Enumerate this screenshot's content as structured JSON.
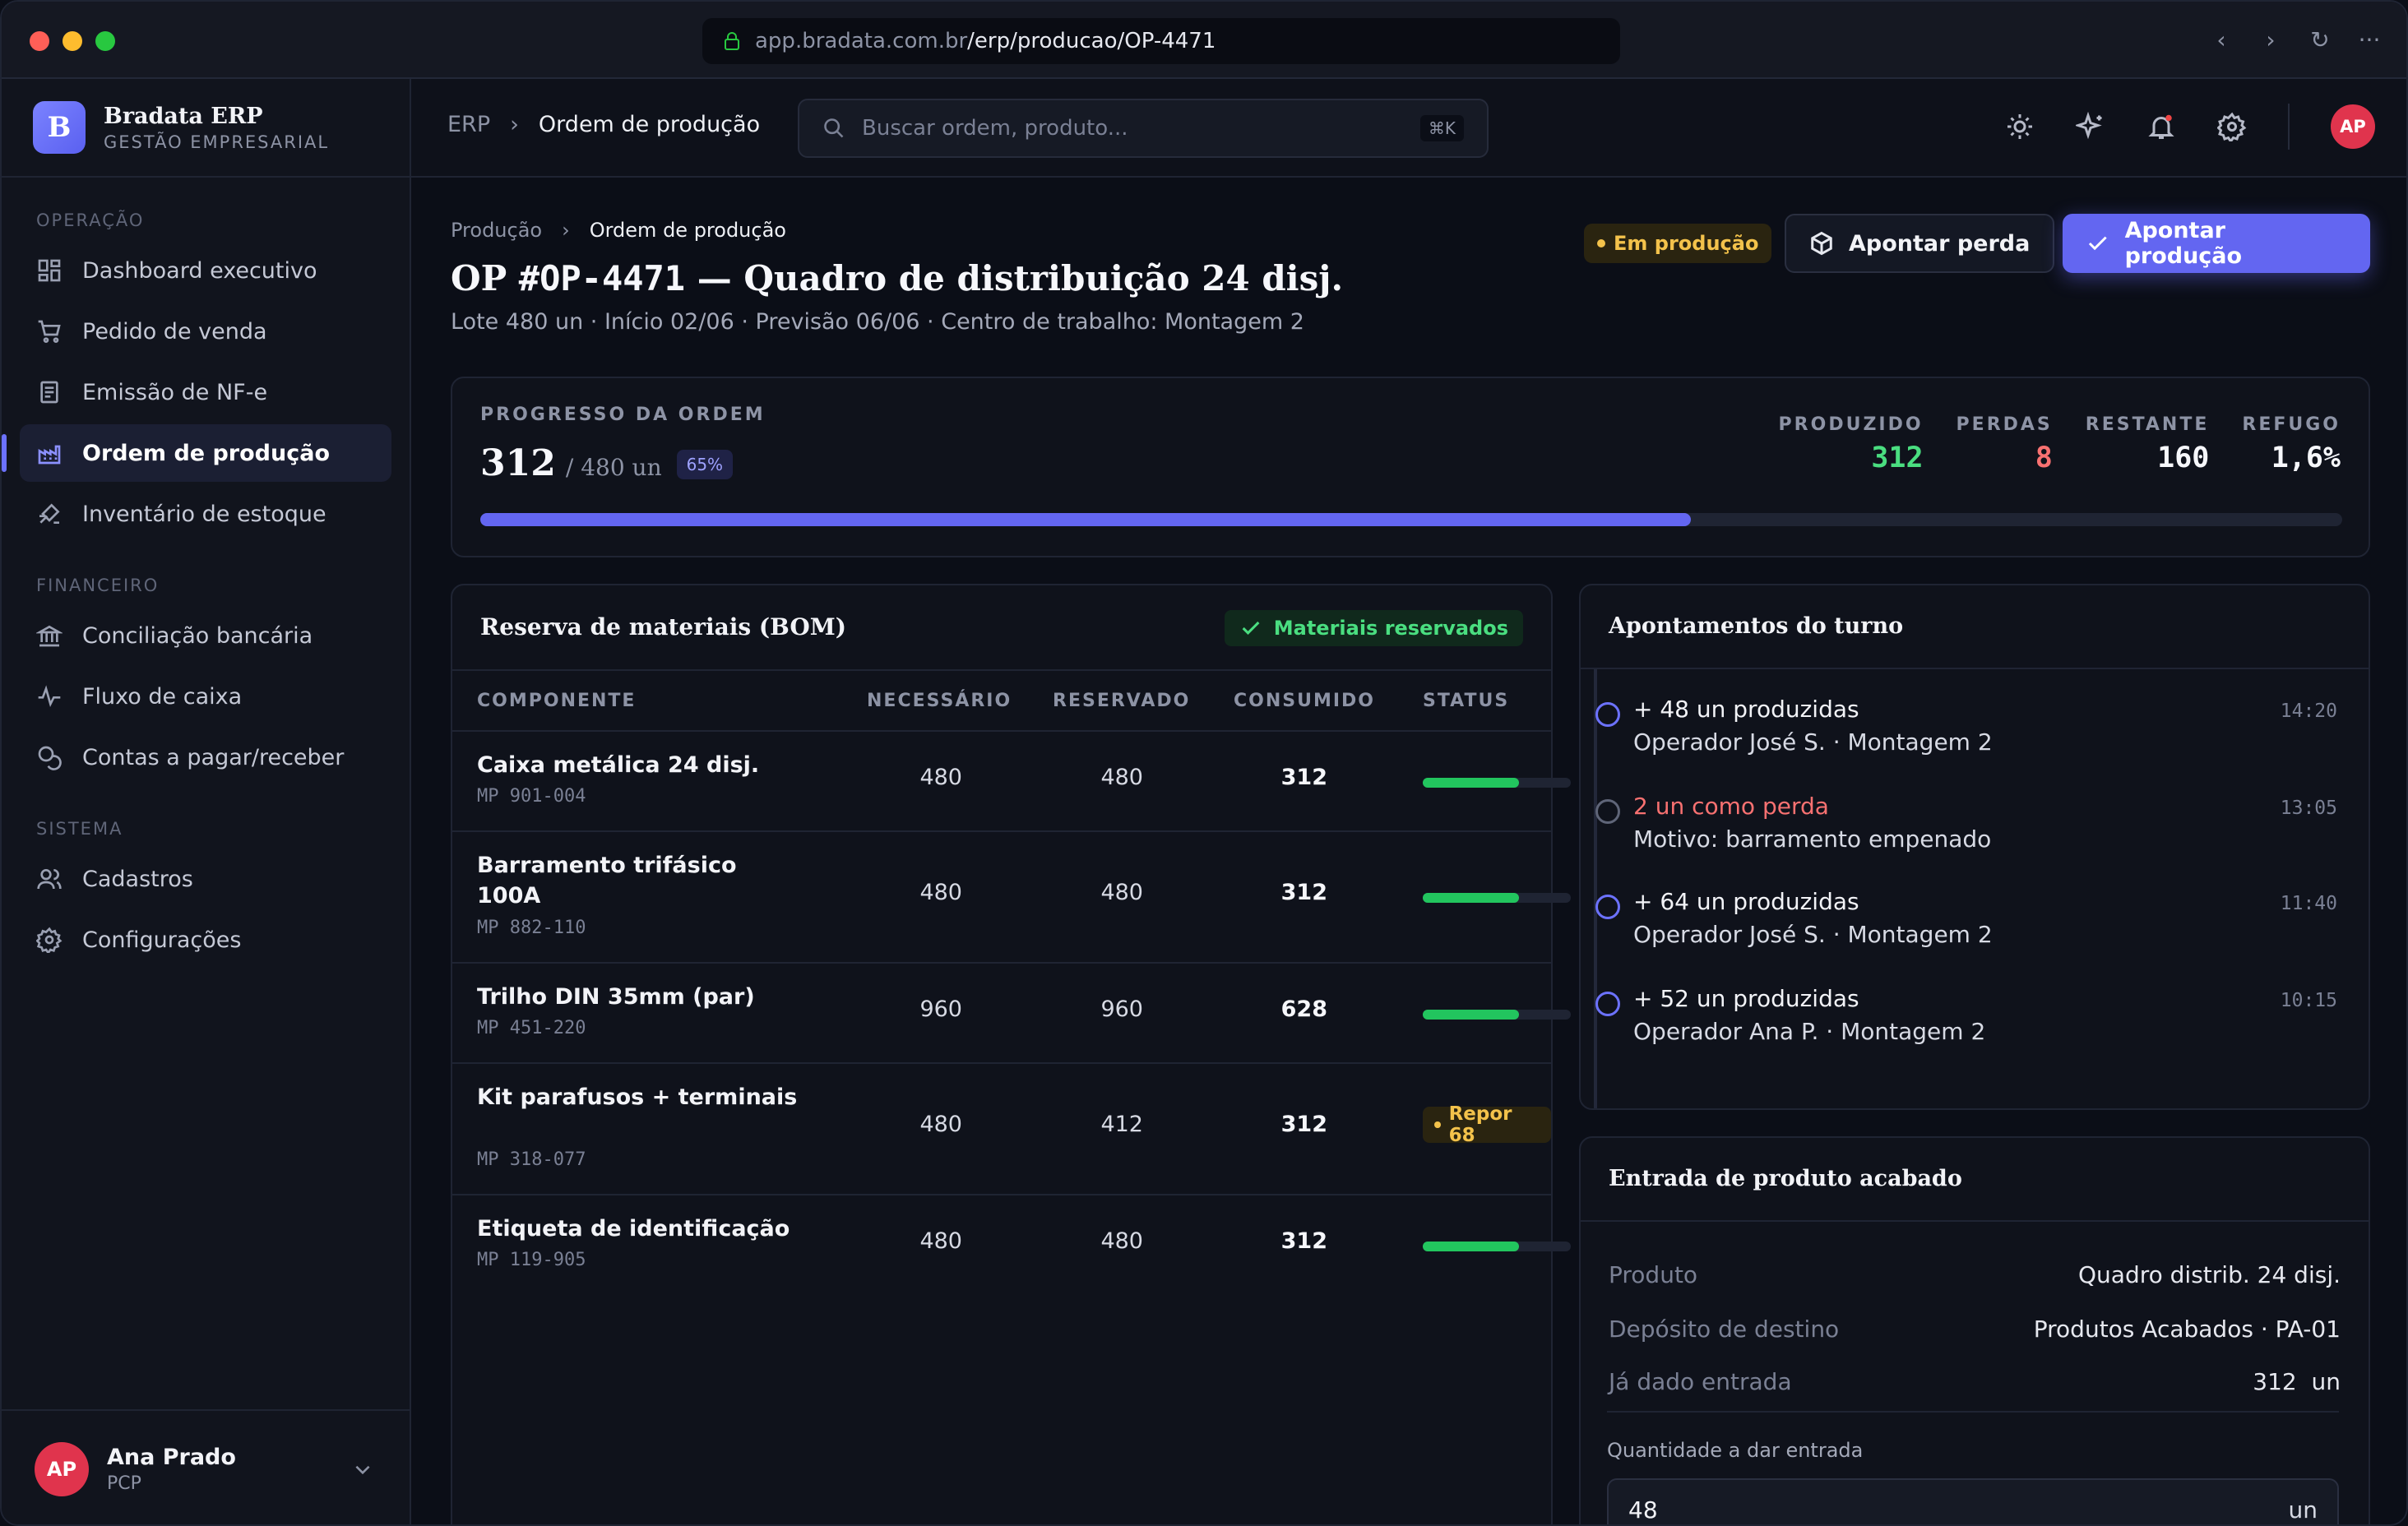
{
  "browser": {
    "url_host": "app.bradata.com.br",
    "url_path": "/erp/producao/OP-4471"
  },
  "brand": {
    "logo_letter": "B",
    "name": "Bradata ERP",
    "subtitle": "GESTÃO EMPRESARIAL"
  },
  "sidebar": {
    "sections": [
      {
        "title": "OPERAÇÃO",
        "items": [
          {
            "label": "Dashboard executivo",
            "icon": "grid-icon"
          },
          {
            "label": "Pedido de venda",
            "icon": "cart-icon"
          },
          {
            "label": "Emissão de NF-e",
            "icon": "document-icon"
          },
          {
            "label": "Ordem de produção",
            "icon": "factory-icon",
            "active": true
          },
          {
            "label": "Inventário de estoque",
            "icon": "inventory-icon"
          }
        ]
      },
      {
        "title": "FINANCEIRO",
        "items": [
          {
            "label": "Conciliação bancária",
            "icon": "bank-icon"
          },
          {
            "label": "Fluxo de caixa",
            "icon": "activity-icon"
          },
          {
            "label": "Contas a pagar/receber",
            "icon": "coins-icon"
          }
        ]
      },
      {
        "title": "SISTEMA",
        "items": [
          {
            "label": "Cadastros",
            "icon": "users-icon"
          },
          {
            "label": "Configurações",
            "icon": "gear-icon"
          }
        ]
      }
    ],
    "user": {
      "initials": "AP",
      "name": "Ana Prado",
      "role": "PCP"
    }
  },
  "topbar": {
    "crumb_root": "ERP",
    "crumb_current": "Ordem de produção",
    "search_placeholder": "Buscar ordem, produto...",
    "search_shortcut": "⌘K",
    "avatar_initials": "AP"
  },
  "page": {
    "breadcrumb_parent": "Produção",
    "breadcrumb_current": "Ordem de produção",
    "title_prefix": "OP ",
    "title_code": "#OP-4471",
    "title_suffix": " — Quadro de distribuição 24 disj.",
    "subtitle": "Lote 480 un · Início 02/06 · Previsão 06/06 · Centro de trabalho: Montagem 2",
    "status": "Em produção",
    "btn_loss": "Apontar perda",
    "btn_production": "Apontar produção"
  },
  "progress": {
    "label": "PROGRESSO DA ORDEM",
    "produced": "312",
    "of_total": "/ 480 un",
    "percent_label": "65%",
    "fraction": 0.65,
    "stats": [
      {
        "key": "PRODUZIDO",
        "value": "312",
        "color": "#4ade80"
      },
      {
        "key": "PERDAS",
        "value": "8",
        "color": "#f87171"
      },
      {
        "key": "RESTANTE",
        "value": "160",
        "color": "#f6f7fb"
      },
      {
        "key": "REFUGO",
        "value": "1,6%",
        "color": "#f6f7fb"
      }
    ]
  },
  "bom": {
    "title": "Reserva de materiais (BOM)",
    "badge": "Materiais reservados",
    "columns": [
      "COMPONENTE",
      "NECESSÁRIO",
      "RESERVADO",
      "CONSUMIDO",
      "STATUS"
    ],
    "rows": [
      {
        "name": "Caixa metálica 24 disj.",
        "code": "MP 901-004",
        "needed": "480",
        "reserved": "480",
        "consumed": "312",
        "status": "bar",
        "fill": 0.65
      },
      {
        "name": "Barramento trifásico 100A",
        "code": "MP 882-110",
        "needed": "480",
        "reserved": "480",
        "consumed": "312",
        "status": "bar",
        "fill": 0.65
      },
      {
        "name": "Trilho DIN 35mm (par)",
        "code": "MP 451-220",
        "needed": "960",
        "reserved": "960",
        "consumed": "628",
        "status": "bar",
        "fill": 0.65
      },
      {
        "name": "Kit parafusos + terminais",
        "code": "MP 318-077",
        "needed": "480",
        "reserved": "412",
        "consumed": "312",
        "status": "Repor 68"
      },
      {
        "name": "Etiqueta de identificação",
        "code": "MP 119-905",
        "needed": "480",
        "reserved": "480",
        "consumed": "312",
        "status": "bar",
        "fill": 0.65
      }
    ]
  },
  "shift": {
    "title": "Apontamentos do turno",
    "events": [
      {
        "line1": "+ 48 un produzidas",
        "line2": "Operador José S. · Montagem 2",
        "time": "14:20",
        "kind": "prod"
      },
      {
        "line1": "2 un como perda",
        "line2": "Motivo: barramento empenado",
        "time": "13:05",
        "kind": "loss"
      },
      {
        "line1": "+ 64 un produzidas",
        "line2": "Operador José S. · Montagem 2",
        "time": "11:40",
        "kind": "prod"
      },
      {
        "line1": "+ 52 un produzidas",
        "line2": "Operador Ana P. · Montagem 2",
        "time": "10:15",
        "kind": "prod"
      }
    ]
  },
  "entry": {
    "title": "Entrada de produto acabado",
    "fields": [
      {
        "key": "Produto",
        "value": "Quadro distrib. 24 disj."
      },
      {
        "key": "Depósito de destino",
        "value": "Produtos Acabados · PA-01"
      },
      {
        "key": "Já dado entrada",
        "value": "312  un"
      }
    ],
    "qty_label": "Quantidade a dar entrada",
    "qty_value": "48",
    "qty_unit": "un"
  }
}
